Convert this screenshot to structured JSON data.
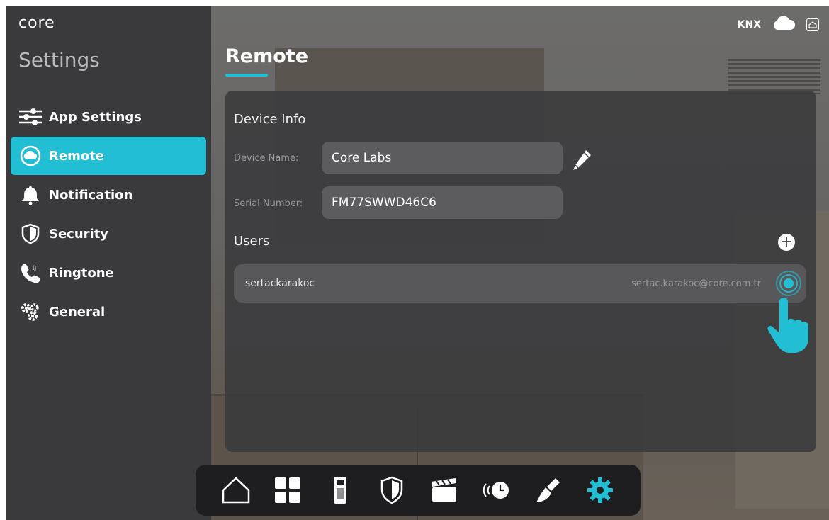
{
  "app": {
    "logo": "core"
  },
  "sidebar": {
    "title": "Settings",
    "items": [
      {
        "label": "App Settings",
        "icon": "sliders-icon"
      },
      {
        "label": "Remote",
        "icon": "cloud-icon",
        "active": true
      },
      {
        "label": "Notification",
        "icon": "bell-icon"
      },
      {
        "label": "Security",
        "icon": "shield-icon"
      },
      {
        "label": "Ringtone",
        "icon": "phone-music-icon"
      },
      {
        "label": "General",
        "icon": "gears-icon"
      }
    ]
  },
  "status": {
    "knx": "KNX",
    "icons": [
      "cloud-icon",
      "home-box-icon"
    ]
  },
  "page": {
    "title": "Remote"
  },
  "device_info": {
    "title": "Device Info",
    "device_name_label": "Device Name:",
    "device_name": "Core Labs",
    "serial_label": "Serial Number:",
    "serial": "FM77SWWD46C6"
  },
  "users": {
    "title": "Users",
    "list": [
      {
        "username": "sertackarakoc",
        "email": "sertac.karakoc@core.com.tr"
      }
    ]
  },
  "dock": {
    "items": [
      "home-icon",
      "grid-icon",
      "intercom-icon",
      "shield-icon",
      "scene-clapper-icon",
      "timer-icon",
      "cleaning-icon",
      "settings-gear-icon"
    ],
    "active": "settings-gear-icon"
  },
  "colors": {
    "accent": "#22bfd4",
    "panel": "#3a3a3c",
    "field": "#5c5c5e"
  }
}
